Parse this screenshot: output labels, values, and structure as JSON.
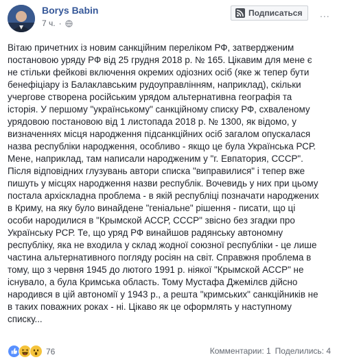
{
  "post": {
    "author": "Borys Babin",
    "time": "7 ч.",
    "subscribe_label": "Подписаться",
    "more": "...",
    "lines": [
      "Вітаю причетних із новим санкційним переліком РФ, затвердженим",
      "постановою уряду РФ від 25 грудня 2018 р. № 165. Цікавим для мене є",
      "не стільки фейкові включення окремих одіозних осіб (яке ж тепер бути",
      "бенефіціару із Балаклавським рудоуправлінням, наприклад), скільки",
      "учергове створена російським урядом альтернативна географія та",
      "історія. У першому \"українському\" санкційному списку РФ, схваленому",
      "урядовою постановою від 1 листопада 2018 р. № 1300, як відомо, у",
      "визначеннях місця народження підсанкційних осіб загалом опускалася",
      "назва республіки народження, особливо - якщо це була Українська РСР.",
      "Мене, наприклад, там написали народженим у \"г. Евпатория, СССР\".",
      "Після відповідних глузувань автори списка \"виправилися\" і тепер вже",
      "пишуть у місцях народження назви республік. Вочевидь у них при цьому",
      "постала архіскладна проблема - в якій республіці позначати народжених",
      "в Криму, на яку було винайдене \"геніальне\" рішення - писати, що ці",
      "особи народилися в \"Крымской АССР, СССР\" звісно без згадки про",
      "Українську РСР. Те, що уряд РФ винайшов радянську автономну",
      "республіку, яка не входила у склад жодної союзної республіки - це лише",
      "частина альтернативного погляду росіян на світ. Справжня проблема в",
      "тому, що з червня 1945 до лютого 1991 р. ніякої \"Крымской АССР\" не",
      "існувало, а була Кримська область. Тому Мустафа Джемілєв дійсно",
      "народився в цій автономії у 1943 р., а решта \"кримських\" санкційників не",
      "в таких поважних роках - ні. Цікаво як це оформлять у наступному",
      "списку..."
    ],
    "reactions_count": "76",
    "comments": "Комментарии: 1",
    "shares": "Поделились: 4"
  },
  "icons": {
    "globe": "globe-icon",
    "subscribe": "rss-icon",
    "like": "like-reaction-icon",
    "haha": "haha-reaction-icon",
    "wow": "wow-reaction-icon"
  },
  "colors": {
    "author": "#365899",
    "text": "#1d2129",
    "muted": "#616770",
    "like": "#5890ff",
    "emoji": "#f5c33b"
  }
}
